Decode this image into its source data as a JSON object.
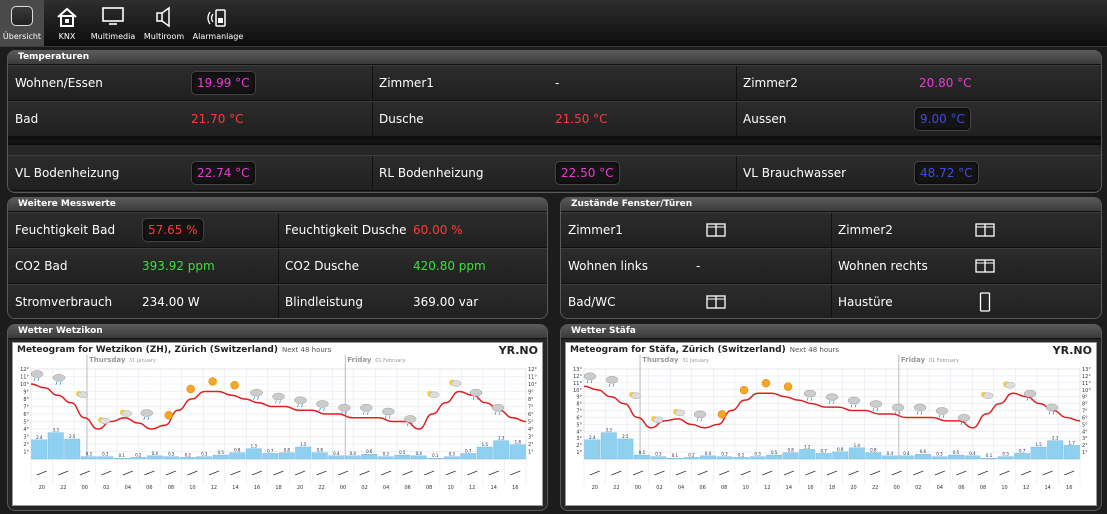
{
  "nav": {
    "items": [
      {
        "label": "Übersicht",
        "icon": "overview-icon",
        "active": true
      },
      {
        "label": "KNX",
        "icon": "home-icon",
        "active": false
      },
      {
        "label": "Multimedia",
        "icon": "monitor-icon",
        "active": false
      },
      {
        "label": "Multiroom",
        "icon": "speaker-icon",
        "active": false
      },
      {
        "label": "Alarmanlage",
        "icon": "alarm-icon",
        "active": false
      }
    ]
  },
  "temperatures": {
    "title": "Temperaturen",
    "rows": [
      [
        {
          "label": "Wohnen/Essen",
          "value": "19.99 °C"
        },
        {
          "label": "Zimmer1",
          "value": "-"
        },
        {
          "label": "Zimmer2",
          "value": "20.80 °C"
        }
      ],
      [
        {
          "label": "Bad",
          "value": "21.70 °C"
        },
        {
          "label": "Dusche",
          "value": "21.50 °C"
        },
        {
          "label": "Aussen",
          "value": "9.00 °C"
        }
      ],
      [
        {
          "label": "VL Bodenheizung",
          "value": "22.74 °C"
        },
        {
          "label": "RL Bodenheizung",
          "value": "22.50 °C"
        },
        {
          "label": "VL Brauchwasser",
          "value": "48.72 °C"
        }
      ]
    ]
  },
  "measurements": {
    "title": "Weitere Messwerte",
    "rows": [
      [
        {
          "label": "Feuchtigkeit Bad",
          "value": "57.65 %"
        },
        {
          "label": "Feuchtigkeit Dusche",
          "value": "60.00 %"
        }
      ],
      [
        {
          "label": "CO2 Bad",
          "value": "393.92 ppm"
        },
        {
          "label": "CO2 Dusche",
          "value": "420.80 ppm"
        }
      ],
      [
        {
          "label": "Stromverbrauch",
          "value": "234.00 W"
        },
        {
          "label": "Blindleistung",
          "value": "369.00 var"
        }
      ]
    ]
  },
  "windows": {
    "title": "Zustände Fenster/Türen",
    "rows": [
      [
        {
          "label": "Zimmer1",
          "value": "",
          "icon": "window-icon"
        },
        {
          "label": "Zimmer2",
          "value": "",
          "icon": "window-icon"
        }
      ],
      [
        {
          "label": "Wohnen links",
          "value": "-",
          "icon": ""
        },
        {
          "label": "Wohnen rechts",
          "value": "",
          "icon": "window-icon"
        }
      ],
      [
        {
          "label": "Bad/WC",
          "value": "",
          "icon": "window-icon"
        },
        {
          "label": "Haustüre",
          "value": "",
          "icon": "door-icon"
        }
      ]
    ]
  },
  "weather1": {
    "title": "Wetter Wetzikon",
    "meteogram_title": "Meteogram for Wetzikon (ZH), Zürich (Switzerland)",
    "meteogram_sub": "Next 48 hours",
    "logo": "YR.NO",
    "day1": "Thursday",
    "day1_date": "31 January",
    "day2": "Friday",
    "day2_date": "01 February",
    "x_ticks": [
      "20",
      "22",
      "00",
      "02",
      "04",
      "06",
      "08",
      "10",
      "12",
      "14",
      "16",
      "18",
      "20",
      "22",
      "00",
      "02",
      "04",
      "06",
      "08",
      "10",
      "12",
      "14",
      "16"
    ],
    "y_ticks": [
      "12°",
      "11°",
      "10°",
      "9°",
      "8°",
      "7°",
      "6°",
      "5°",
      "4°",
      "3°",
      "2°",
      "1°"
    ],
    "temps": [
      10,
      9.5,
      8.5,
      7.5,
      5.5,
      4,
      5,
      5.5,
      4.8,
      4,
      4.5,
      6.5,
      8,
      9,
      9,
      8.5,
      8,
      7.5,
      7,
      7,
      6.5,
      6.5,
      6,
      6,
      5.5,
      5.5,
      5.5,
      5,
      5,
      4,
      6,
      7.5,
      9,
      8.5,
      7.5,
      6.5,
      5.5,
      5
    ],
    "precip": [
      "2.4",
      "3.3",
      "2.5",
      "0.3",
      "0.3",
      "0.1",
      "0.2",
      "0.4",
      "0.3",
      "0.2",
      "0.3",
      "0.5",
      "0.8",
      "1.3",
      "0.7",
      "0.8",
      "1.5",
      "0.8",
      "0.4",
      "0.4",
      "0.6",
      "0.3",
      "0.5",
      "0.4",
      "0.1",
      "0.3",
      "0.7",
      "1.5",
      "2.3",
      "1.8"
    ]
  },
  "weather2": {
    "title": "Wetter Stäfa",
    "meteogram_title": "Meteogram for Stäfa, Zürich (Switzerland)",
    "meteogram_sub": "Next 48 hours",
    "logo": "YR.NO",
    "day1": "Thursday",
    "day1_date": "31 January",
    "day2": "Friday",
    "day2_date": "01 February",
    "x_ticks": [
      "20",
      "22",
      "00",
      "02",
      "04",
      "06",
      "08",
      "10",
      "12",
      "14",
      "16",
      "18",
      "20",
      "22",
      "00",
      "02",
      "04",
      "06",
      "08",
      "10",
      "12",
      "14",
      "16"
    ],
    "y_ticks": [
      "13°",
      "12°",
      "11°",
      "10°",
      "9°",
      "8°",
      "7°",
      "6°",
      "5°",
      "4°",
      "3°",
      "2°",
      "1°"
    ],
    "temps": [
      10.5,
      10,
      9,
      8,
      6,
      4.5,
      5.5,
      5.8,
      5,
      4.5,
      5,
      7,
      8.5,
      9.5,
      9.5,
      9,
      8.5,
      8,
      7.5,
      7.5,
      7,
      7,
      6.5,
      6.5,
      6,
      6,
      6,
      5.5,
      5.5,
      4.5,
      6.5,
      8,
      9.5,
      9,
      8,
      7,
      6,
      5.5
    ],
    "precip": [
      "2.4",
      "3.3",
      "2.5",
      "0.5",
      "0.3",
      "0.1",
      "0.2",
      "0.4",
      "0.3",
      "0.2",
      "0.3",
      "0.5",
      "0.8",
      "1.2",
      "0.7",
      "0.9",
      "1.4",
      "0.8",
      "0.4",
      "0.4",
      "0.6",
      "0.3",
      "0.5",
      "0.4",
      "0.1",
      "0.3",
      "0.7",
      "1.5",
      "2.3",
      "1.7"
    ]
  }
}
